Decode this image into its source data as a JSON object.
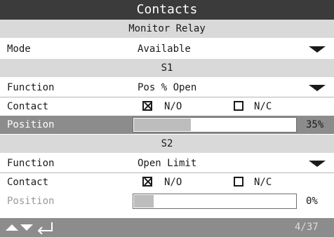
{
  "title": "Contacts",
  "monitor_relay": {
    "heading": "Monitor Relay",
    "mode_label": "Mode",
    "mode_value": "Available"
  },
  "s1": {
    "heading": "S1",
    "function_label": "Function",
    "function_value": "Pos % Open",
    "contact_label": "Contact",
    "no_label": "N/O",
    "nc_label": "N/C",
    "no_checked": true,
    "nc_checked": false,
    "position_label": "Position",
    "position_value": 35,
    "position_text": "35%"
  },
  "s2": {
    "heading": "S2",
    "function_label": "Function",
    "function_value": "Open Limit",
    "contact_label": "Contact",
    "no_label": "N/O",
    "nc_label": "N/C",
    "no_checked": true,
    "nc_checked": false,
    "position_label": "Position",
    "position_value": 0,
    "position_text": "0%"
  },
  "footer": {
    "page": "4/37",
    "icons": [
      "up-arrow-icon",
      "down-arrow-icon",
      "enter-icon"
    ]
  },
  "colors": {
    "title_bg": "#3b3b3b",
    "section_bg": "#d9d9d9",
    "highlight_bg": "#8c8c8c",
    "bar_fill": "#bdbdbd"
  }
}
